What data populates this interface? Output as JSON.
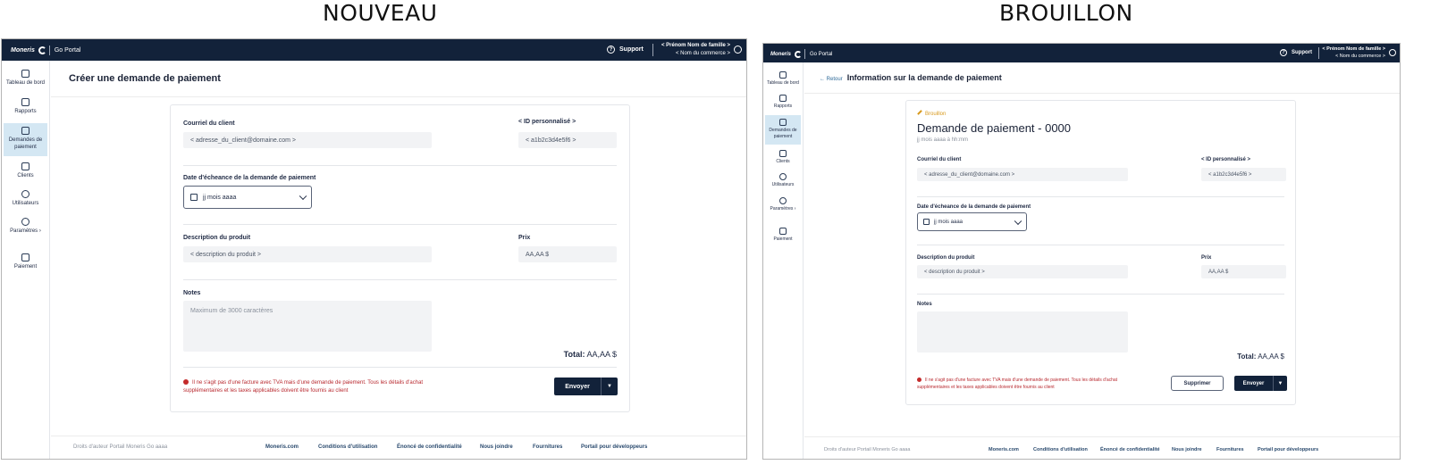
{
  "captions": {
    "new": "NOUVEAU",
    "draft": "BROUILLON"
  },
  "header": {
    "logo_brand": "Moneris",
    "logo_product": "Go Portal",
    "support": "Support",
    "user_name": "< Prénom Nom de famille >",
    "business_name": "< Nom du commerce >"
  },
  "sidebar": {
    "items": [
      {
        "label": "Tableau de bord",
        "icon": "dashboard-icon"
      },
      {
        "label": "Rapports",
        "icon": "reports-icon"
      },
      {
        "label": "Demandes de paiement",
        "icon": "payment-requests-icon"
      },
      {
        "label": "Clients",
        "icon": "clients-icon"
      },
      {
        "label": "Utilisateurs",
        "icon": "users-icon"
      },
      {
        "label": "Paramètres",
        "icon": "settings-icon"
      },
      {
        "label": "Paiement",
        "icon": "payment-icon"
      }
    ],
    "active_index": 2
  },
  "new_form": {
    "page_title": "Créer une demande de paiement",
    "email_label": "Courriel du client",
    "email_value": "< adresse_du_client@domaine.com >",
    "custom_id_label": "< ID personnalisé >",
    "custom_id_value": "< a1b2c3d4e5f6 >",
    "due_date_label": "Date d'écheance de la demande de paiement",
    "due_date_value": "jj mois aaaa",
    "product_label": "Description du produit",
    "product_value": "< description du produit >",
    "price_label": "Prix",
    "price_value": "AA,AA $",
    "notes_label": "Notes",
    "notes_placeholder": "Maximum de 3000 caractères",
    "total_label": "Total:",
    "total_value": "AA,AA  $",
    "disclaimer_line1": "Il ne s'agit pas d'une facture avec TVA mais d'une demande de paiement. Tous les détails d'achat",
    "disclaimer_line2": "supplémentaires et les taxes applicables doivent être fournis au client",
    "send_label": "Envoyer"
  },
  "draft_form": {
    "back_label": "← Retour",
    "page_title": "Information sur la demande de paiement",
    "status": "Brouillon",
    "request_title": "Demande de paiement - ",
    "request_number": "0000",
    "request_date": "jj mois aaaa à hh:mm",
    "email_label": "Courriel du client",
    "email_value": "< adresse_du_client@domaine.com >",
    "custom_id_label": "< ID personnalisé >",
    "custom_id_value": "< a1b2c3d4e5f6 >",
    "due_date_label": "Date d'écheance de la demande de paiement",
    "due_date_value": "jj mois aaaa",
    "product_label": "Description du produit",
    "product_value": "< description du produit >",
    "price_label": "Prix",
    "price_value": "AA,AA $",
    "notes_label": "Notes",
    "total_label": "Total:",
    "total_value": "AA,AA  $",
    "disclaimer_line1": "Il ne s'agit pas d'une facture avec TVA mais d'une demande de paiement. Tous les détails d'achat",
    "disclaimer_line2": "supplémentaires et les taxes applicables doivent être fournis au client",
    "delete_label": "Supprimer",
    "send_label": "Envoyer"
  },
  "footer": {
    "copyright": "Droits d'auteur Portail Moneris Go  aaaa",
    "links": [
      "Moneris.com",
      "Conditions d'utilisation",
      "Énoncé de confidentialité",
      "Nous joindre",
      "Fournitures",
      "Portail pour développeurs"
    ]
  },
  "colors": {
    "topbar": "#12223a",
    "active_nav": "#d4e7f3",
    "warning": "#b8292f",
    "draft_status": "#d89a1e"
  }
}
